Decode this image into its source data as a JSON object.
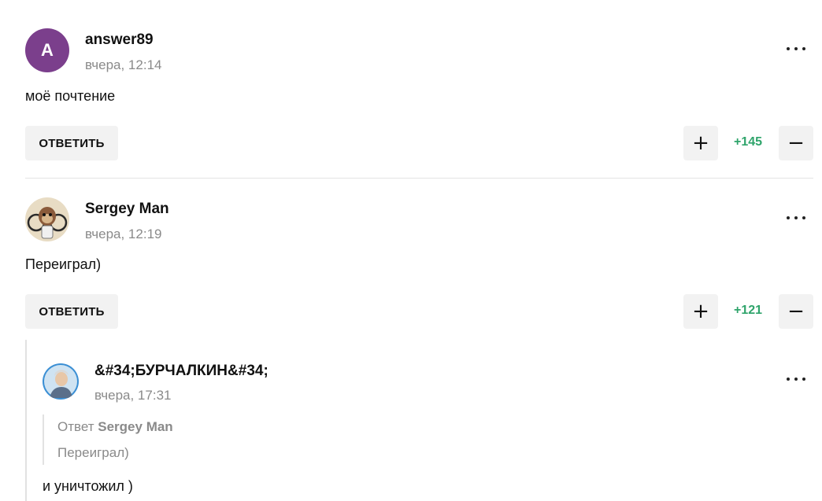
{
  "comments": [
    {
      "avatar_letter": "A",
      "author": "answer89",
      "time": "вчера, 12:14",
      "text": "моё почтение",
      "reply_label": "ОТВЕТИТЬ",
      "score": "+145"
    },
    {
      "author": "Sergey Man",
      "time": "вчера, 12:19",
      "text": "Переиграл)",
      "reply_label": "ОТВЕТИТЬ",
      "score": "+121"
    },
    {
      "author": "&#34;БУРЧАЛКИН&#34;",
      "time": "вчера, 17:31",
      "quote_prefix": "Ответ",
      "quote_author": "Sergey Man",
      "quote_text": "Переиграл)",
      "text": "и уничтожил )"
    }
  ],
  "icons": {
    "upvote": "+",
    "downvote": "−"
  },
  "colors": {
    "avatar_a": "#7b3f8c",
    "score_positive": "#2fa46b",
    "button_bg": "#f2f2f2"
  }
}
